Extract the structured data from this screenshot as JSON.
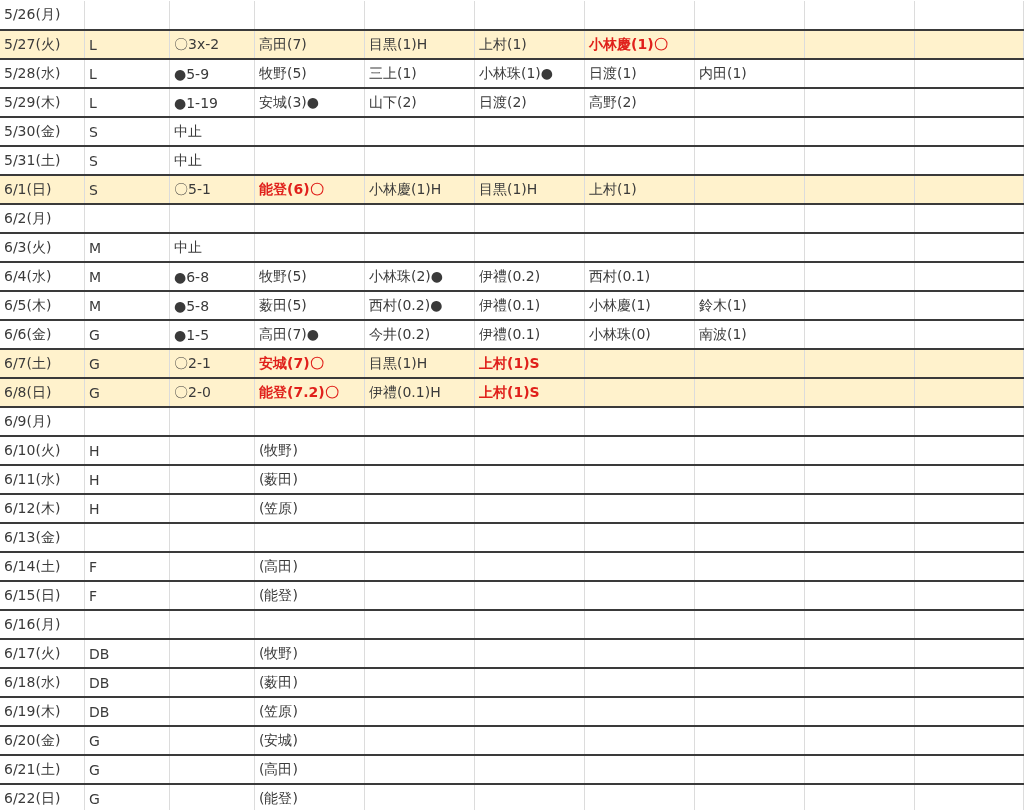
{
  "table": {
    "rows": [
      {
        "highlighted": false,
        "cells": [
          {
            "text": "5/26(月)",
            "emphasis": false
          }
        ]
      },
      {
        "highlighted": true,
        "cells": [
          {
            "text": "5/27(火)",
            "emphasis": false
          },
          {
            "text": "L",
            "emphasis": false
          },
          {
            "text": "〇3x-2",
            "emphasis": false
          },
          {
            "text": "高田(7)",
            "emphasis": false
          },
          {
            "text": "目黒(1)H",
            "emphasis": false
          },
          {
            "text": "上村(1)",
            "emphasis": false
          },
          {
            "text": "小林慶(1)〇",
            "emphasis": true
          }
        ]
      },
      {
        "highlighted": false,
        "cells": [
          {
            "text": "5/28(水)",
            "emphasis": false
          },
          {
            "text": "L",
            "emphasis": false
          },
          {
            "text": "●5-9",
            "emphasis": false
          },
          {
            "text": "牧野(5)",
            "emphasis": false
          },
          {
            "text": "三上(1)",
            "emphasis": false
          },
          {
            "text": "小林珠(1)●",
            "emphasis": false
          },
          {
            "text": "日渡(1)",
            "emphasis": false
          },
          {
            "text": "内田(1)",
            "emphasis": false
          }
        ]
      },
      {
        "highlighted": false,
        "cells": [
          {
            "text": "5/29(木)",
            "emphasis": false
          },
          {
            "text": "L",
            "emphasis": false
          },
          {
            "text": "●1-19",
            "emphasis": false
          },
          {
            "text": "安城(3)●",
            "emphasis": false
          },
          {
            "text": "山下(2)",
            "emphasis": false
          },
          {
            "text": "日渡(2)",
            "emphasis": false
          },
          {
            "text": "高野(2)",
            "emphasis": false
          }
        ]
      },
      {
        "highlighted": false,
        "cells": [
          {
            "text": "5/30(金)",
            "emphasis": false
          },
          {
            "text": "S",
            "emphasis": false
          },
          {
            "text": "中止",
            "emphasis": false
          }
        ]
      },
      {
        "highlighted": false,
        "cells": [
          {
            "text": "5/31(土)",
            "emphasis": false
          },
          {
            "text": "S",
            "emphasis": false
          },
          {
            "text": "中止",
            "emphasis": false
          }
        ]
      },
      {
        "highlighted": true,
        "cells": [
          {
            "text": "6/1(日)",
            "emphasis": false
          },
          {
            "text": "S",
            "emphasis": false
          },
          {
            "text": "〇5-1",
            "emphasis": false
          },
          {
            "text": "能登(6)〇",
            "emphasis": true
          },
          {
            "text": "小林慶(1)H",
            "emphasis": false
          },
          {
            "text": "目黒(1)H",
            "emphasis": false
          },
          {
            "text": "上村(1)",
            "emphasis": false
          }
        ]
      },
      {
        "highlighted": false,
        "cells": [
          {
            "text": "6/2(月)",
            "emphasis": false
          }
        ]
      },
      {
        "highlighted": false,
        "cells": [
          {
            "text": "6/3(火)",
            "emphasis": false
          },
          {
            "text": "M",
            "emphasis": false
          },
          {
            "text": "中止",
            "emphasis": false
          }
        ]
      },
      {
        "highlighted": false,
        "cells": [
          {
            "text": "6/4(水)",
            "emphasis": false
          },
          {
            "text": "M",
            "emphasis": false
          },
          {
            "text": "●6-8",
            "emphasis": false
          },
          {
            "text": "牧野(5)",
            "emphasis": false
          },
          {
            "text": "小林珠(2)●",
            "emphasis": false
          },
          {
            "text": "伊禮(0.2)",
            "emphasis": false
          },
          {
            "text": "西村(0.1)",
            "emphasis": false
          }
        ]
      },
      {
        "highlighted": false,
        "cells": [
          {
            "text": "6/5(木)",
            "emphasis": false
          },
          {
            "text": "M",
            "emphasis": false
          },
          {
            "text": "●5-8",
            "emphasis": false
          },
          {
            "text": "薮田(5)",
            "emphasis": false
          },
          {
            "text": "西村(0.2)●",
            "emphasis": false
          },
          {
            "text": "伊禮(0.1)",
            "emphasis": false
          },
          {
            "text": "小林慶(1)",
            "emphasis": false
          },
          {
            "text": "鈴木(1)",
            "emphasis": false
          }
        ]
      },
      {
        "highlighted": false,
        "cells": [
          {
            "text": "6/6(金)",
            "emphasis": false
          },
          {
            "text": "G",
            "emphasis": false
          },
          {
            "text": "●1-5",
            "emphasis": false
          },
          {
            "text": "高田(7)●",
            "emphasis": false
          },
          {
            "text": "今井(0.2)",
            "emphasis": false
          },
          {
            "text": "伊禮(0.1)",
            "emphasis": false
          },
          {
            "text": "小林珠(0)",
            "emphasis": false
          },
          {
            "text": "南波(1)",
            "emphasis": false
          }
        ]
      },
      {
        "highlighted": true,
        "cells": [
          {
            "text": "6/7(土)",
            "emphasis": false
          },
          {
            "text": "G",
            "emphasis": false
          },
          {
            "text": "〇2-1",
            "emphasis": false
          },
          {
            "text": "安城(7)〇",
            "emphasis": true
          },
          {
            "text": "目黒(1)H",
            "emphasis": false
          },
          {
            "text": "上村(1)S",
            "emphasis": true
          }
        ]
      },
      {
        "highlighted": true,
        "cells": [
          {
            "text": "6/8(日)",
            "emphasis": false
          },
          {
            "text": "G",
            "emphasis": false
          },
          {
            "text": "〇2-0",
            "emphasis": false
          },
          {
            "text": "能登(7.2)〇",
            "emphasis": true
          },
          {
            "text": "伊禮(0.1)H",
            "emphasis": false
          },
          {
            "text": "上村(1)S",
            "emphasis": true
          }
        ]
      },
      {
        "highlighted": false,
        "cells": [
          {
            "text": "6/9(月)",
            "emphasis": false
          }
        ]
      },
      {
        "highlighted": false,
        "cells": [
          {
            "text": "6/10(火)",
            "emphasis": false
          },
          {
            "text": "H",
            "emphasis": false
          },
          null,
          {
            "text": "(牧野)",
            "emphasis": false
          }
        ]
      },
      {
        "highlighted": false,
        "cells": [
          {
            "text": "6/11(水)",
            "emphasis": false
          },
          {
            "text": "H",
            "emphasis": false
          },
          null,
          {
            "text": "(薮田)",
            "emphasis": false
          }
        ]
      },
      {
        "highlighted": false,
        "cells": [
          {
            "text": "6/12(木)",
            "emphasis": false
          },
          {
            "text": "H",
            "emphasis": false
          },
          null,
          {
            "text": "(笠原)",
            "emphasis": false
          }
        ]
      },
      {
        "highlighted": false,
        "cells": [
          {
            "text": "6/13(金)",
            "emphasis": false
          }
        ]
      },
      {
        "highlighted": false,
        "cells": [
          {
            "text": "6/14(土)",
            "emphasis": false
          },
          {
            "text": "F",
            "emphasis": false
          },
          null,
          {
            "text": "(高田)",
            "emphasis": false
          }
        ]
      },
      {
        "highlighted": false,
        "cells": [
          {
            "text": "6/15(日)",
            "emphasis": false
          },
          {
            "text": "F",
            "emphasis": false
          },
          null,
          {
            "text": "(能登)",
            "emphasis": false
          }
        ]
      },
      {
        "highlighted": false,
        "cells": [
          {
            "text": "6/16(月)",
            "emphasis": false
          }
        ]
      },
      {
        "highlighted": false,
        "cells": [
          {
            "text": "6/17(火)",
            "emphasis": false
          },
          {
            "text": "DB",
            "emphasis": false
          },
          null,
          {
            "text": "(牧野)",
            "emphasis": false
          }
        ]
      },
      {
        "highlighted": false,
        "cells": [
          {
            "text": "6/18(水)",
            "emphasis": false
          },
          {
            "text": "DB",
            "emphasis": false
          },
          null,
          {
            "text": "(薮田)",
            "emphasis": false
          }
        ]
      },
      {
        "highlighted": false,
        "cells": [
          {
            "text": "6/19(木)",
            "emphasis": false
          },
          {
            "text": "DB",
            "emphasis": false
          },
          null,
          {
            "text": "(笠原)",
            "emphasis": false
          }
        ]
      },
      {
        "highlighted": false,
        "cells": [
          {
            "text": "6/20(金)",
            "emphasis": false
          },
          {
            "text": "G",
            "emphasis": false
          },
          null,
          {
            "text": "(安城)",
            "emphasis": false
          }
        ]
      },
      {
        "highlighted": false,
        "cells": [
          {
            "text": "6/21(土)",
            "emphasis": false
          },
          {
            "text": "G",
            "emphasis": false
          },
          null,
          {
            "text": "(高田)",
            "emphasis": false
          }
        ]
      },
      {
        "highlighted": false,
        "cells": [
          {
            "text": "6/22(日)",
            "emphasis": false
          },
          {
            "text": "G",
            "emphasis": false
          },
          null,
          {
            "text": "(能登)",
            "emphasis": false
          }
        ]
      }
    ]
  }
}
